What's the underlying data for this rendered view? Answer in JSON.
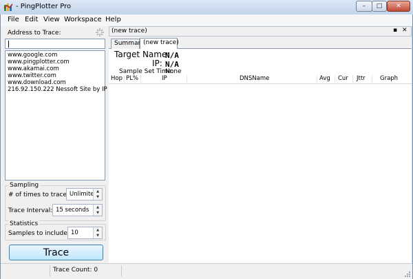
{
  "window": {
    "title": "- PingPlotter Pro",
    "minimize_glyph": "–",
    "maximize_glyph": "□",
    "close_glyph": "✕"
  },
  "menu": [
    "File",
    "Edit",
    "View",
    "Workspace",
    "Help"
  ],
  "left": {
    "address_label": "Address to Trace:",
    "address_value": "",
    "addresses": [
      "www.google.com",
      "www.pingplotter.com",
      "www.akamai.com",
      "www.twitter.com",
      "www.download.com",
      "216.92.150.222 Nessoft Site by IP"
    ],
    "sampling_title": "Sampling",
    "times_label": "# of times to trace:",
    "times_value": "Unlimited",
    "interval_label": "Trace Interval:",
    "interval_value": "15 seconds",
    "statistics_title": "Statistics",
    "samples_label": "Samples to include:",
    "samples_value": "10",
    "trace_button": "Trace"
  },
  "doc": {
    "header_title": "(new trace)",
    "pin_glyph": "▪",
    "close_glyph": "✕",
    "tabs": [
      "Summary",
      "(new trace)"
    ],
    "target_label": "Target Name:",
    "target_value": "N/A",
    "ip_label": "IP:",
    "ip_value": "N/A",
    "sample_time_label": "Sample Set Time:",
    "sample_time_value": "None",
    "columns": [
      "Hop",
      "PL%",
      "IP",
      "DNSName",
      "Avg",
      "Cur",
      "Jttr",
      "Graph"
    ]
  },
  "status": {
    "trace_count": "Trace Count: 0"
  },
  "colors": {
    "title_gradient_top": "#dde9f6",
    "close_red": "#c24a34",
    "trace_button_top": "#eaf6fd"
  },
  "icons": {
    "app": "pingplotter-app-icon",
    "address_tool": "spark-icon",
    "spin_up": "spin-up-arrow-icon",
    "spin_down": "spin-down-arrow-icon"
  }
}
